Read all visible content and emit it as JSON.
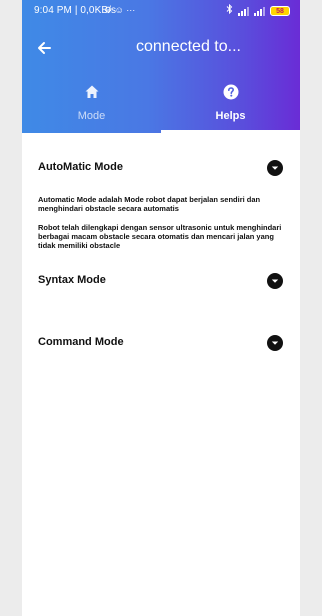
{
  "status_bar": {
    "time_and_speed": "9:04 PM | 0,0KB/s",
    "extra_icons": "⚙ ☺ ···",
    "battery": "58",
    "bluetooth_icon": "bluetooth-icon"
  },
  "header": {
    "title": "connected to...",
    "back_icon": "arrow-left-icon",
    "gradient_start": "#3f8ae6",
    "gradient_end": "#6a2cd6"
  },
  "tabs": [
    {
      "label": "Mode",
      "icon": "home-icon",
      "selected": false
    },
    {
      "label": "Helps",
      "icon": "help-circle-icon",
      "selected": true
    }
  ],
  "sections": [
    {
      "title": "AutoMatic Mode",
      "expanded": true,
      "paragraphs": [
        "Automatic Mode adalah Mode robot dapat berjalan sendiri dan menghindari obstacle secara automatis",
        "Robot telah dilengkapi dengan sensor ultrasonic untuk menghindari berbagai macam obstacle secara otomatis dan mencari jalan yang tidak memiliki obstacle"
      ]
    },
    {
      "title": "Syntax Mode",
      "expanded": false,
      "paragraphs": []
    },
    {
      "title": "Command Mode",
      "expanded": false,
      "paragraphs": []
    }
  ]
}
